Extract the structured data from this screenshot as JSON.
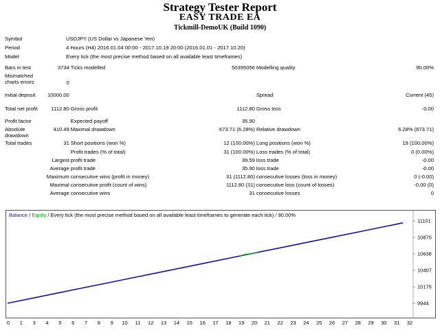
{
  "header": {
    "title": "Strategy Tester Report",
    "ea_name": "EASY TRADE EA",
    "server": "Tickmill-DemoUK (Build 1090)"
  },
  "report": {
    "symbol_label": "Symbol",
    "symbol_value": "USDJPY (US Dollar vs Japanese Yen)",
    "period_label": "Period",
    "period_value": "4 Hours (H4) 2016.01.04 00:00 - 2017.10.19 20:00 (2016.01.01 - 2017.10.20)",
    "model_label": "Model",
    "model_value": "Every tick (the most precise method based on all available least timeframes)",
    "bars_label": "Bars in test",
    "bars_value": "3734",
    "ticks_label": "Ticks modelled",
    "ticks_value": "50395056",
    "quality_label": "Modelling quality",
    "quality_value": "90.00%",
    "mismatched_label": "Mismatched charts errors",
    "mismatched_value": "0",
    "deposit_label": "Initial deposit",
    "deposit_value": "10000.00",
    "spread_label": "Spread",
    "spread_value": "Current (45)",
    "netprofit_label": "Total net profit",
    "netprofit_value": "1112.80",
    "grossprofit_label": "Gross profit",
    "grossprofit_value": "1112.80",
    "grossloss_label": "Gross loss",
    "grossloss_value": "-0.00",
    "pf_label": "Profit factor",
    "expected_label": "Expected payoff",
    "expected_value": "35.90",
    "absdd_label": "Absolute drawdown",
    "absdd_value": "410.49",
    "maxdd_label": "Maximal drawdown",
    "maxdd_value": "673.71 (6.28%)",
    "reldd_label": "Relative drawdown",
    "reldd_value": "6.28% (673.71)",
    "trades_label": "Total trades",
    "trades_value": "31",
    "short_label": "Short positions (won %)",
    "short_value": "12 (100.00%)",
    "long_label": "Long positions (won %)",
    "long_value": "19 (100.00%)",
    "ptrades_label": "Profit trades (% of total)",
    "ptrades_value": "31 (100.00%)",
    "ltrades_label": "Loss trades (% of total)",
    "ltrades_value": "0 (0.00%)",
    "largest_label": "Largest",
    "profit_trade_label": "profit trade",
    "largest_profit": "39.59",
    "loss_trade_label": "loss trade",
    "largest_loss": "-0.00",
    "average_label": "Average",
    "average_profit": "35.90",
    "average_loss": "-0.00",
    "maximum_label": "Maximum",
    "cons_wins_money_label": "consecutive wins (profit in money)",
    "cons_wins_money_value": "31 (1112.80)",
    "cons_losses_money_label": "consecutive losses (loss in money)",
    "cons_losses_money_value": "0 (-0.00)",
    "maximal_label": "Maximal",
    "cons_profit_count_label": "consecutive profit (count of wins)",
    "cons_profit_count_value": "1112.80 (31)",
    "cons_loss_count_label": "consecutive loss (count of losses)",
    "cons_loss_count_value": "-0.00 (0)",
    "avg_label": "Average",
    "cons_wins_label": "consecutive wins",
    "cons_wins_value": "31",
    "cons_losses_label": "consecutive losses",
    "cons_losses_value": "0"
  },
  "chart_header": {
    "balance": "Balance",
    "sep1": " / ",
    "equity": "Equity",
    "rest": " / Every tick (the most precise method based on all available least timeframes to generate each tick) / 90.00%"
  },
  "chart_data": {
    "type": "line",
    "x_ticks": [
      "0",
      "1",
      "3",
      "4",
      "5",
      "6",
      "7",
      "8",
      "9",
      "10",
      "11",
      "12",
      "13",
      "14",
      "15",
      "16",
      "17",
      "18",
      "19",
      "20",
      "21",
      "22",
      "23",
      "24",
      "25",
      "26",
      "27",
      "28",
      "29",
      "30",
      "31",
      "32"
    ],
    "y_ticks": [
      "11101",
      "10870",
      "10638",
      "10407",
      "10175",
      "9944"
    ],
    "ylim": [
      9944,
      11101
    ],
    "xlim": [
      0,
      32.2
    ],
    "series": [
      {
        "name": "Balance",
        "color": "#1010a0",
        "x": [
          0,
          2,
          4,
          6,
          8,
          10,
          12,
          14,
          16,
          18,
          19,
          20,
          22,
          24,
          26,
          28,
          30,
          31,
          31.5
        ],
        "y": [
          9944,
          10016,
          10088,
          10160,
          10231,
          10303,
          10375,
          10446,
          10518,
          10590,
          10626,
          10662,
          10733,
          10805,
          10876,
          10948,
          11020,
          11056,
          11075
        ]
      },
      {
        "name": "Equity",
        "color": "#00a000",
        "x": [
          18.5,
          19,
          19.5,
          20
        ],
        "y": [
          10611,
          10632,
          10641,
          10666
        ]
      }
    ],
    "colors": {
      "balance": "#1010a0",
      "equity": "#00a000"
    }
  }
}
